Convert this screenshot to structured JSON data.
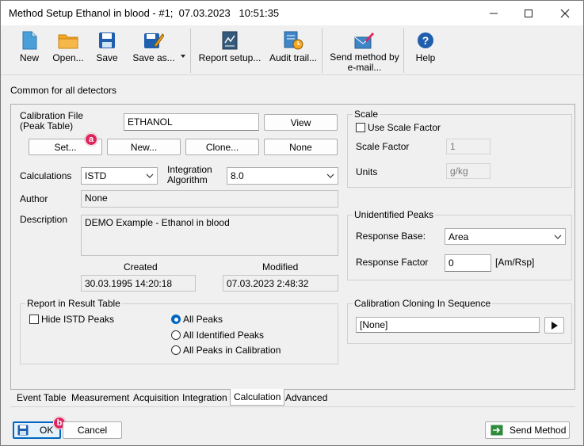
{
  "window": {
    "title": "Method Setup Ethanol in blood - #1;  07.03.2023   10:51:35",
    "minimize_icon": "minimize-icon",
    "maximize_icon": "maximize-icon",
    "close_icon": "close-icon"
  },
  "toolbar": {
    "new": "New",
    "open": "Open...",
    "save": "Save",
    "save_as": "Save as...",
    "report_setup": "Report setup...",
    "audit_trail": "Audit trail...",
    "send_method_line1": "Send method by",
    "send_method_line2": "e-mail...",
    "help": "Help"
  },
  "section_label": "Common for all detectors",
  "calibration": {
    "label_line1": "Calibration File",
    "label_line2": "(Peak Table)",
    "file_value": "ETHANOL",
    "view": "View",
    "set": "Set...",
    "new": "New...",
    "clone": "Clone...",
    "none": "None"
  },
  "calculations": {
    "label": "Calculations",
    "value": "ISTD"
  },
  "integration": {
    "label_line1": "Integration",
    "label_line2": "Algorithm",
    "value": "8.0"
  },
  "author": {
    "label": "Author",
    "value": "None"
  },
  "description": {
    "label": "Description",
    "value": "DEMO Example - Ethanol in blood"
  },
  "created": {
    "label": "Created",
    "value": "30.03.1995 14:20:18"
  },
  "modified": {
    "label": "Modified",
    "value": "07.03.2023 2:48:32"
  },
  "report": {
    "title": "Report in Result Table",
    "hide_istd": "Hide ISTD Peaks",
    "all_peaks": "All Peaks",
    "all_identified": "All Identified Peaks",
    "all_in_calibration": "All Peaks in Calibration"
  },
  "scale": {
    "title": "Scale",
    "use_scale_factor": "Use Scale Factor",
    "factor_label": "Scale Factor",
    "factor_value": "1",
    "units_label": "Units",
    "units_value": "g/kg"
  },
  "unidentified": {
    "title": "Unidentified Peaks",
    "response_base_label": "Response Base:",
    "response_base_value": "Area",
    "response_factor_label": "Response Factor",
    "response_factor_value": "0",
    "response_factor_unit": "[Am/Rsp]"
  },
  "cloning": {
    "title": "Calibration Cloning In Sequence",
    "value": "[None]"
  },
  "tabs": [
    "Event Table",
    "Measurement",
    "Acquisition",
    "Integration",
    "Calculation",
    "Advanced"
  ],
  "footer": {
    "ok": "OK",
    "cancel": "Cancel",
    "send_method": "Send Method"
  },
  "badges": {
    "a": "a",
    "b": "b"
  },
  "colors": {
    "accent": "#0067c0",
    "badge": "#e0245e"
  }
}
